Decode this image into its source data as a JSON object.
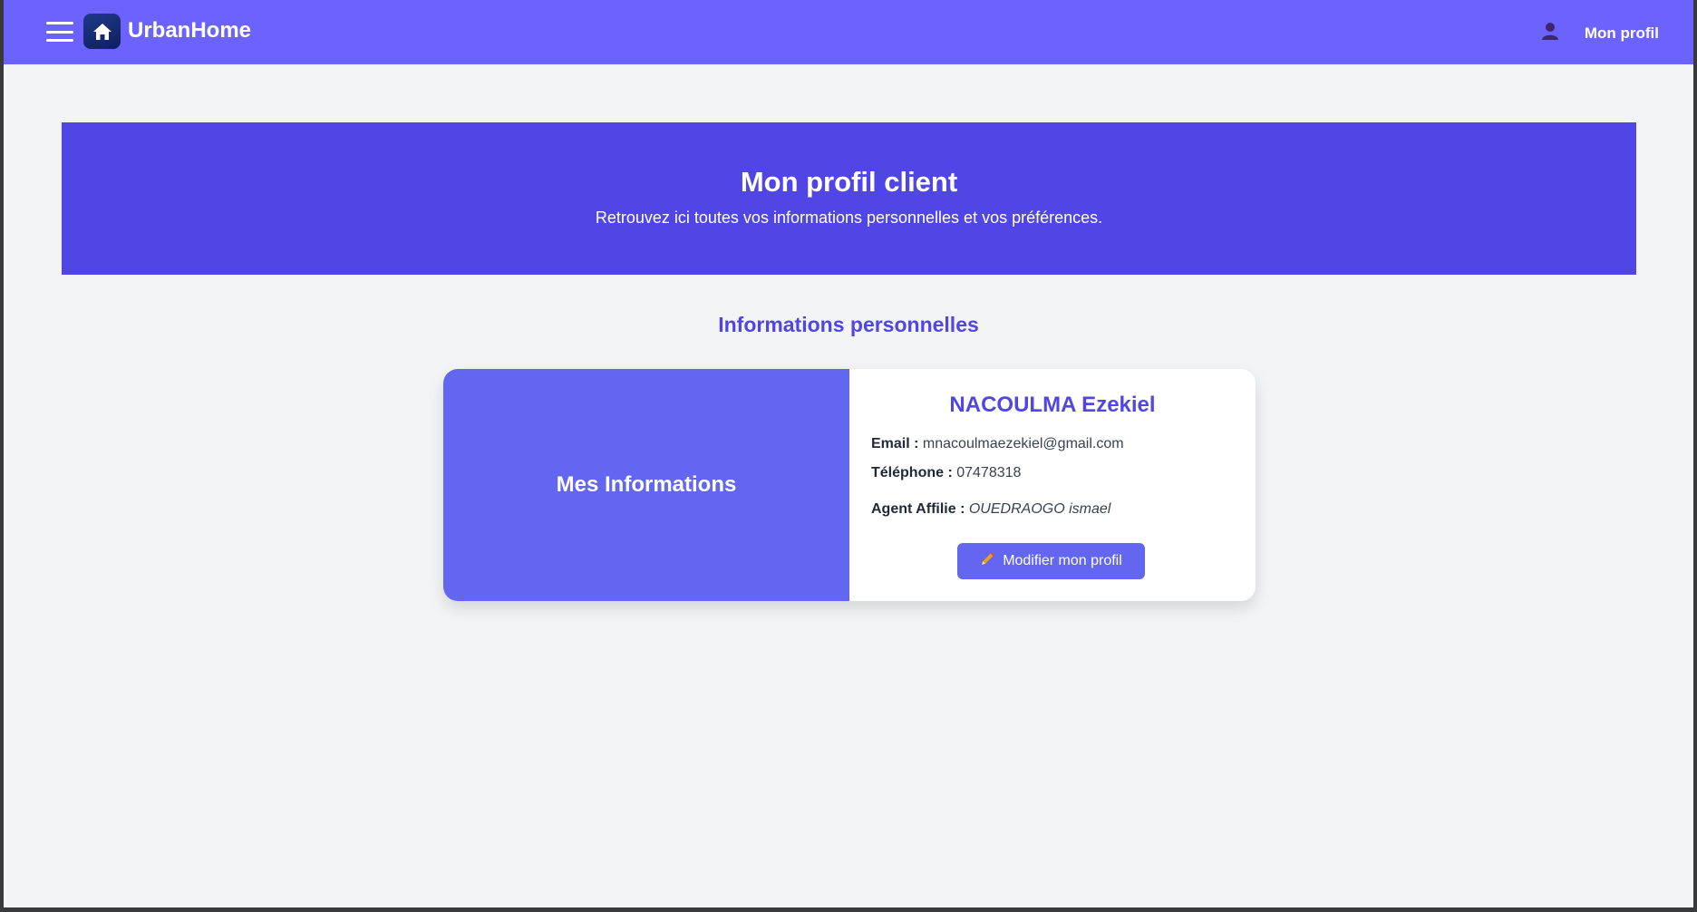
{
  "header": {
    "brand": "UrbanHome",
    "profile_label": "Mon profil",
    "menu_icon": "hamburger-menu-icon",
    "logo_icon": "home-icon",
    "user_icon": "user-icon"
  },
  "banner": {
    "title": "Mon profil client",
    "subtitle": "Retrouvez ici toutes vos informations personnelles et vos préférences."
  },
  "section": {
    "title": "Informations personnelles"
  },
  "card": {
    "left_title": "Mes Informations",
    "name": "NACOULMA Ezekiel",
    "email_label": "Email :",
    "email_value": "mnacoulmaezekiel@gmail.com",
    "phone_label": "Téléphone :",
    "phone_value": "07478318",
    "agent_label": "Agent Affilie :",
    "agent_value": "OUEDRAOGO ismael",
    "edit_button": "Modifier mon profil",
    "edit_icon": "pencil-icon"
  },
  "colors": {
    "topbar": "#6c63ff",
    "banner": "#4f46e5",
    "accent": "#6366f1",
    "page_bg": "#f3f4f6"
  }
}
